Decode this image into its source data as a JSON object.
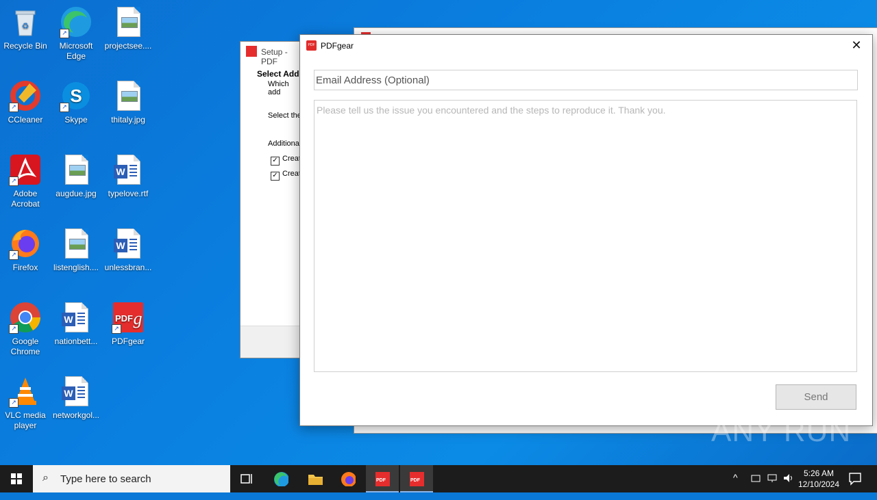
{
  "desktop": {
    "icons": [
      {
        "label": "Recycle Bin",
        "icon": "recycle-bin-icon"
      },
      {
        "label": "Microsoft Edge",
        "icon": "edge-icon"
      },
      {
        "label": "projectsee....",
        "icon": "image-file-icon"
      },
      {
        "label": "CCleaner",
        "icon": "ccleaner-icon"
      },
      {
        "label": "Skype",
        "icon": "skype-icon"
      },
      {
        "label": "thitaly.jpg",
        "icon": "image-file-icon"
      },
      {
        "label": "Adobe Acrobat",
        "icon": "acrobat-icon"
      },
      {
        "label": "augdue.jpg",
        "icon": "image-file-icon"
      },
      {
        "label": "typelove.rtf",
        "icon": "word-doc-icon"
      },
      {
        "label": "Firefox",
        "icon": "firefox-icon"
      },
      {
        "label": "listenglish....",
        "icon": "image-file-icon"
      },
      {
        "label": "unlessbran...",
        "icon": "word-doc-icon"
      },
      {
        "label": "Google Chrome",
        "icon": "chrome-icon"
      },
      {
        "label": "nationbett...",
        "icon": "word-doc-icon"
      },
      {
        "label": "PDFgear",
        "icon": "pdfgear-icon"
      },
      {
        "label": "VLC media player",
        "icon": "vlc-icon"
      },
      {
        "label": "networkgol...",
        "icon": "word-doc-icon"
      }
    ]
  },
  "setup_window": {
    "title": "Setup - PDF",
    "heading": "Select Addi",
    "subheading": "Which add",
    "select_text": "Select the",
    "additional_label": "Additiona",
    "checkboxes": [
      {
        "label": "Creat",
        "checked": true
      },
      {
        "label": "Creat",
        "checked": true
      }
    ]
  },
  "dialog": {
    "title": "PDFgear",
    "email_placeholder": "Email Address (Optional)",
    "email_value": "",
    "issue_placeholder": "Please tell us the issue you encountered and the steps to reproduce it. Thank you.",
    "send_label": "Send",
    "close_glyph": "✕"
  },
  "watermark": "ANY RUN",
  "taskbar": {
    "search_placeholder": "Type here to search",
    "time": "5:26 AM",
    "date": "12/10/2024"
  }
}
